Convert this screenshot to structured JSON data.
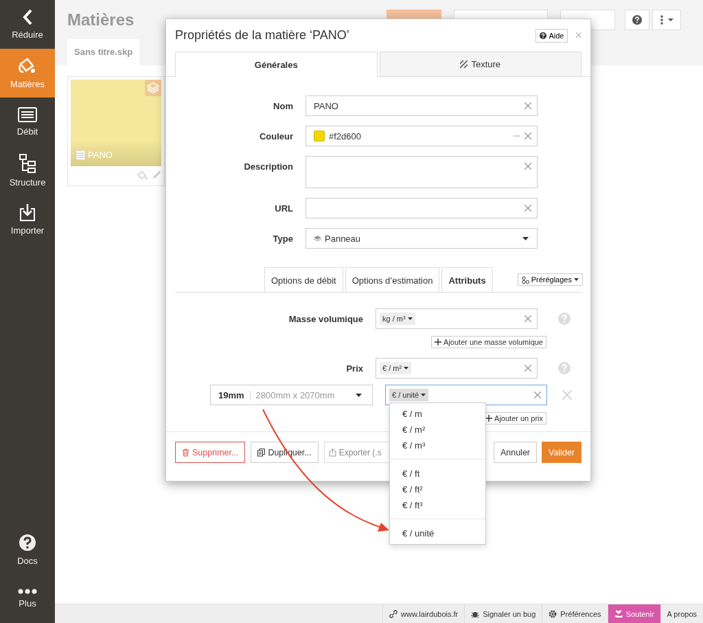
{
  "sidebar": {
    "items": [
      {
        "label": "Réduire",
        "kind": "back",
        "selected": false
      },
      {
        "label": "Matières",
        "kind": "materials",
        "selected": true
      },
      {
        "label": "Débit",
        "kind": "cutlist",
        "selected": false
      },
      {
        "label": "Structure",
        "kind": "structure",
        "selected": false
      },
      {
        "label": "Importer",
        "kind": "import",
        "selected": false
      }
    ],
    "bottom_items": [
      {
        "label": "Docs",
        "kind": "docs",
        "selected": false
      },
      {
        "label": "Plus",
        "kind": "more",
        "selected": false
      }
    ]
  },
  "header": {
    "title": "Matières",
    "buttons": [
      {
        "kind": "primary"
      },
      {
        "kind": "new"
      },
      {
        "kind": "options"
      }
    ]
  },
  "file_tab": {
    "label": "Sans titre.skp"
  },
  "material_card": {
    "name": "PANO"
  },
  "dialog": {
    "title": "Propriétés de la matière ‘PANO’",
    "help_button": "Aide",
    "close": "×",
    "tabs": [
      {
        "label": "Générales",
        "selected": true
      },
      {
        "label": "Texture",
        "selected": false
      }
    ],
    "fields": [
      {
        "label": "Nom",
        "kind": "text",
        "value": "PANO"
      },
      {
        "label": "Couleur",
        "kind": "color",
        "value": "#f2d600",
        "color": "#f2d600"
      },
      {
        "label": "Description",
        "kind": "textarea"
      },
      {
        "label": "URL",
        "kind": "text"
      },
      {
        "label": "Type",
        "kind": "select",
        "value": "Panneau"
      }
    ],
    "subtabs": [
      {
        "label": "Options de débit",
        "selected": false
      },
      {
        "label": "Options d’estimation",
        "selected": false
      },
      {
        "label": "Attributs",
        "selected": true
      }
    ],
    "presets_button": "Préréglages",
    "density": {
      "label": "Masse volumique",
      "unit": "kg / m³",
      "add_button": "Ajouter une masse volumique"
    },
    "price": {
      "label": "Prix",
      "unit": "€ / m²"
    },
    "price_variant": {
      "thickness": "19mm",
      "dimensions": "2800mm x 2070mm",
      "unit": "€ / unité",
      "focused": true,
      "add_button": "Ajouter un prix"
    },
    "footer_buttons": [
      {
        "label": "Supprimer...",
        "kind": "danger"
      },
      {
        "label": "Dupliquer...",
        "kind": "duplicate"
      },
      {
        "label": "Exporter (.s",
        "kind": "export"
      },
      {
        "label": "Annuler",
        "kind": "default"
      },
      {
        "label": "Valider",
        "kind": "primary"
      }
    ]
  },
  "unit_menu": {
    "groups": [
      [
        "€ / m",
        "€ / m²",
        "€ / m³"
      ],
      [
        "€ / ft",
        "€ / ft²",
        "€ / ft³"
      ],
      [
        "€ / unité"
      ]
    ]
  },
  "status_bar": {
    "items": [
      {
        "label": "www.lairdubois.fr",
        "kind": "link"
      },
      {
        "label": "Signaler un bug",
        "kind": "bug"
      },
      {
        "label": "Préférences",
        "kind": "prefs"
      },
      {
        "label": "Soutenir",
        "kind": "support"
      },
      {
        "label": "A propos",
        "kind": "about"
      }
    ]
  }
}
